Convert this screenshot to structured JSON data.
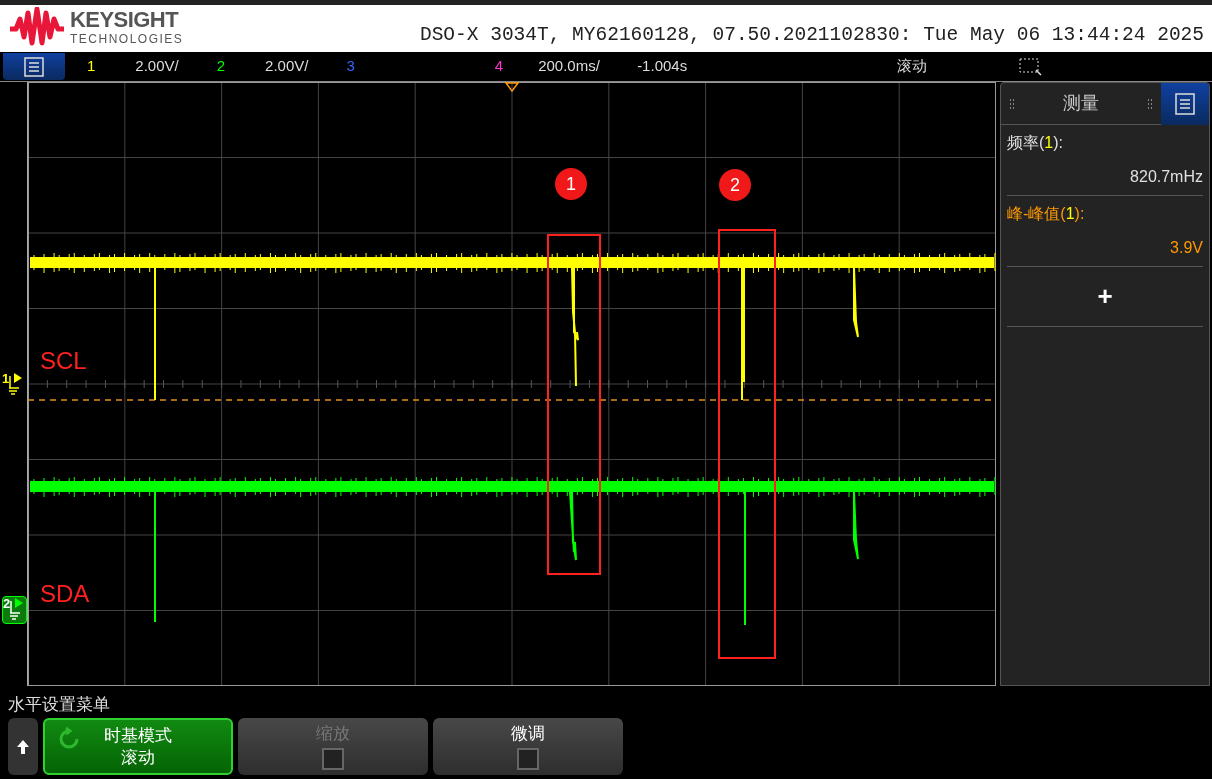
{
  "header": {
    "brand": "KEYSIGHT",
    "brand_sub": "TECHNOLOGIES",
    "info": "DSO-X 3034T, MY62160128, 07.50.2021102830: Tue May 06 13:44:24 2025"
  },
  "channel_bar": {
    "channels": [
      {
        "number": "1",
        "scale": "2.00V/",
        "color": "#ffff00"
      },
      {
        "number": "2",
        "scale": "2.00V/",
        "color": "#00ff00"
      },
      {
        "number": "3",
        "color": "#3366ff"
      },
      {
        "number": "4",
        "color": "#ff33cc"
      }
    ],
    "timebase": "200.0ms/",
    "delay": "-1.004s",
    "mode": "滚动"
  },
  "waveform": {
    "traces": [
      {
        "label": "SCL",
        "marker": "1",
        "color": "#ffff00"
      },
      {
        "label": "SDA",
        "marker": "2",
        "color": "#00ff00"
      }
    ],
    "annotations": [
      {
        "number": "1"
      },
      {
        "number": "2"
      }
    ]
  },
  "measurements": {
    "title": "测量",
    "items": [
      {
        "label_before": "频率(",
        "source": "1",
        "label_after": "):",
        "value": "820.7mHz",
        "color": "#e0e0e0"
      },
      {
        "label_before": "峰-峰值(",
        "source": "1",
        "label_after": "):",
        "value": "3.9V",
        "color": "#ff9900"
      }
    ],
    "add": "+"
  },
  "softkeys": {
    "menu_title": "水平设置菜单",
    "keys": [
      {
        "kind": "mode",
        "label": "时基模式",
        "value": "滚动",
        "selected": true
      },
      {
        "kind": "checkbox",
        "label": "缩放",
        "checked": false,
        "disabled": true
      },
      {
        "kind": "checkbox",
        "label": "微调",
        "checked": false,
        "disabled": false
      }
    ]
  }
}
